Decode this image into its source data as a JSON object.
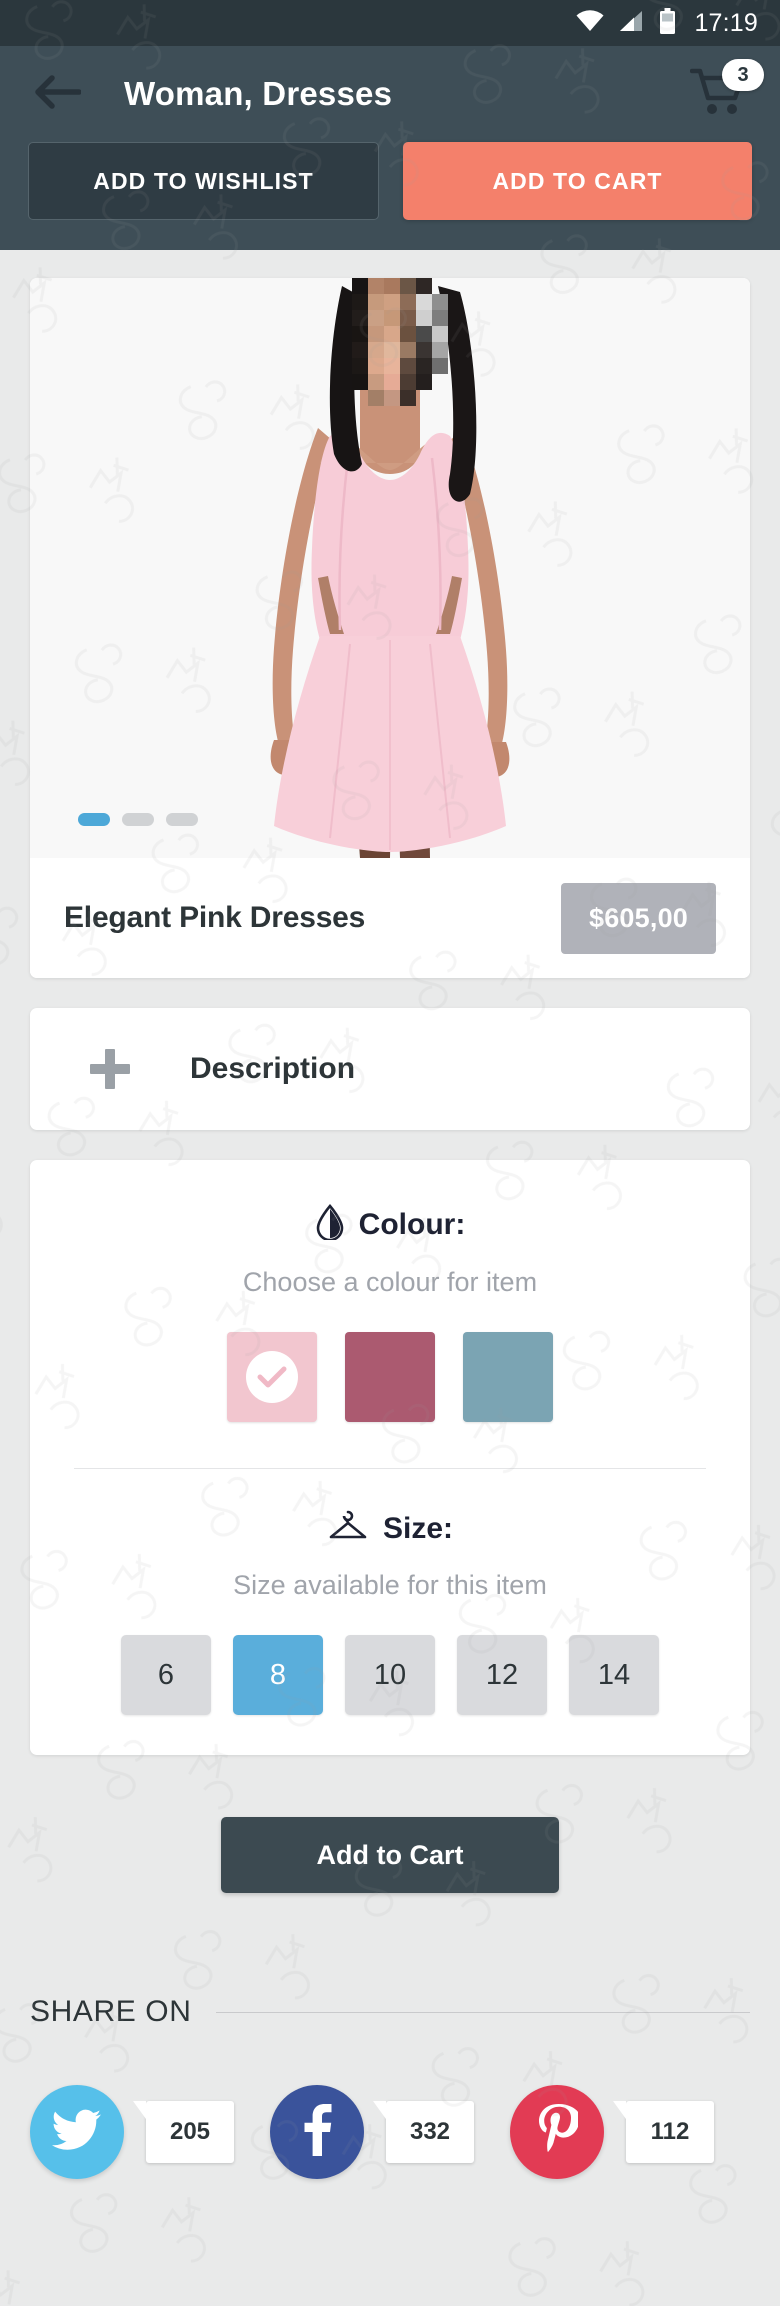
{
  "status_bar": {
    "time": "17:19",
    "icons": [
      "wifi-icon",
      "signal-icon",
      "battery-icon"
    ]
  },
  "header": {
    "back_icon": "back-arrow-icon",
    "title": "Woman, Dresses",
    "cart_icon": "shopping-cart-icon",
    "cart_badge": "3",
    "wishlist_label": "ADD TO WISHLIST",
    "addcart_label": "ADD TO CART",
    "bg_color": "#3e4e57",
    "accent_color": "#f4806b"
  },
  "product": {
    "name": "Elegant Pink Dresses",
    "price": "$605,00",
    "image_alt": "woman wearing pink skater dress",
    "carousel": {
      "count": 3,
      "active_index": 0
    }
  },
  "description": {
    "label": "Description",
    "toggle_icon": "plus-icon",
    "expanded": false
  },
  "colour": {
    "icon": "droplet-icon",
    "title": "Colour:",
    "subtitle": "Choose a colour for item",
    "selected_index": 0,
    "swatches": [
      {
        "name": "light-pink",
        "hex": "#f2c6cf"
      },
      {
        "name": "rose-mauve",
        "hex": "#ab5a70"
      },
      {
        "name": "blue-grey",
        "hex": "#7ba4b3"
      }
    ]
  },
  "size": {
    "icon": "hanger-icon",
    "title": "Size:",
    "subtitle": "Size available for this item",
    "selected": "8",
    "options": [
      "6",
      "8",
      "10",
      "12",
      "14"
    ],
    "selected_color": "#5aaedb"
  },
  "cta": {
    "add_to_cart_label": "Add to Cart"
  },
  "share": {
    "label": "SHARE ON",
    "items": [
      {
        "name": "twitter",
        "icon": "twitter-icon",
        "count": "205",
        "color": "#56c0ea"
      },
      {
        "name": "facebook",
        "icon": "facebook-icon",
        "count": "332",
        "color": "#3a539b"
      },
      {
        "name": "pinterest",
        "icon": "pinterest-icon",
        "count": "112",
        "color": "#e23b54"
      }
    ]
  }
}
